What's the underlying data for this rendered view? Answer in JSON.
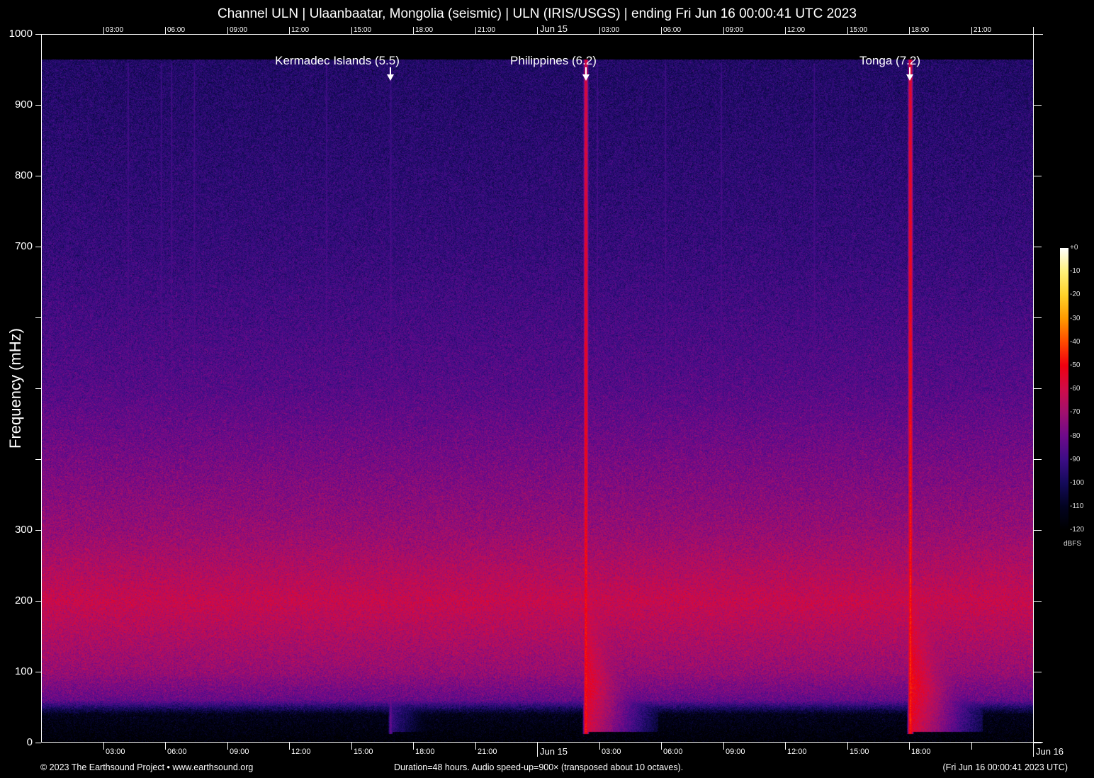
{
  "title": "Channel ULN | Ulaanbaatar, Mongolia (seismic) | ULN (IRIS/USGS) | ending Fri Jun 16 00:00:41 UTC 2023",
  "footer": {
    "copyright": "© 2023 The Earthsound Project • www.earthsound.org",
    "duration": "Duration=48 hours. Audio speed-up=900× (transposed about 10 octaves).",
    "end_time": "(Fri Jun 16 00:00:41 2023 UTC)"
  },
  "chart_data": {
    "type": "heatmap",
    "subtype": "spectrogram",
    "ylabel": "Frequency (mHz)",
    "ylim": [
      0,
      1000
    ],
    "xlim_hours": [
      0,
      48
    ],
    "y_ticks": [
      0,
      100,
      200,
      300,
      400,
      500,
      600,
      700,
      800,
      900,
      1000
    ],
    "y_tick_labels": [
      "0",
      "100",
      "200",
      "300",
      "",
      "",
      "",
      "700",
      "800",
      "900",
      "1000"
    ],
    "x_tick_hours": [
      3,
      6,
      9,
      12,
      15,
      18,
      21,
      24,
      27,
      30,
      33,
      36,
      39,
      42,
      45,
      48
    ],
    "x_top_labels": [
      "03:00",
      "06:00",
      "09:00",
      "12:00",
      "15:00",
      "18:00",
      "21:00",
      "Jun 15",
      "03:00",
      "06:00",
      "09:00",
      "12:00",
      "15:00",
      "18:00",
      "21:00",
      ""
    ],
    "x_bottom_labels": [
      "03:00",
      "06:00",
      "09:00",
      "12:00",
      "15:00",
      "18:00",
      "21:00",
      "Jun 15",
      "03:00",
      "06:00",
      "09:00",
      "12:00",
      "15:00",
      "18:00",
      "",
      "Jun 16"
    ],
    "colorbar": {
      "label": "dBFS",
      "range": [
        -120,
        0
      ],
      "ticks": [
        "+0",
        "-10",
        "-20",
        "-30",
        "-40",
        "-50",
        "-60",
        "-70",
        "-80",
        "-90",
        "-100",
        "-110",
        "-120"
      ],
      "colors": [
        "#000000",
        "#020320",
        "#140a5a",
        "#3c0d86",
        "#6e0a8a",
        "#a0106e",
        "#d00c48",
        "#f00010",
        "#ff4a00",
        "#ff9a00",
        "#ffd22a",
        "#fff27a",
        "#ffffff"
      ]
    },
    "background_profile_dbfs": {
      "frequency_mhz": [
        0,
        40,
        60,
        100,
        200,
        300,
        500,
        700,
        900,
        965
      ],
      "level": [
        -118,
        -112,
        -82,
        -72,
        -62,
        -72,
        -85,
        -92,
        -96,
        -97
      ]
    },
    "events": [
      {
        "label": "Kermadec Islands (5.5)",
        "hour": 16.9,
        "peak_dbfs": -82
      },
      {
        "label": "Philippines (6.2)",
        "hour": 26.35,
        "peak_dbfs": -48
      },
      {
        "label": "Tonga (7.2)",
        "hour": 42.05,
        "peak_dbfs": -45
      }
    ],
    "minor_lines_hours": [
      4.2,
      5.8,
      6.3,
      7.4,
      13.8,
      26.9,
      30.2,
      32.9,
      37.4
    ]
  }
}
